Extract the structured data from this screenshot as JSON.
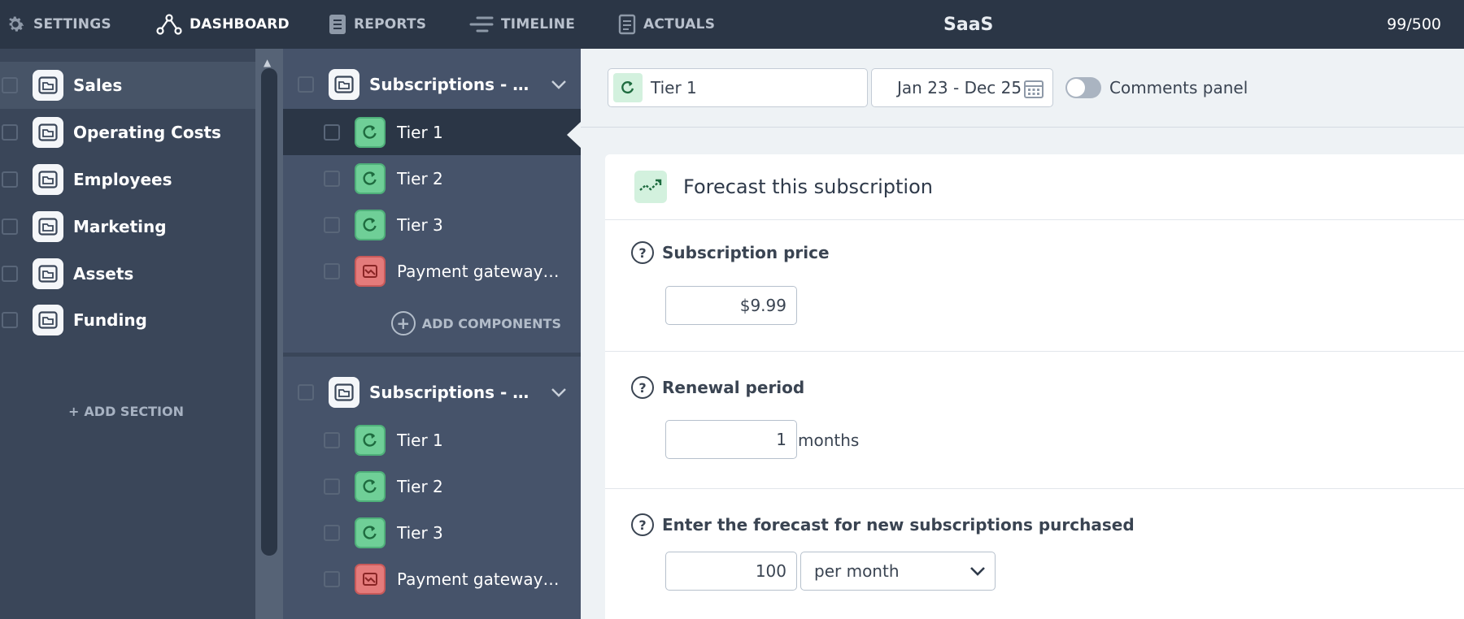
{
  "nav": {
    "settings": "SETTINGS",
    "dashboard": "DASHBOARD",
    "reports": "REPORTS",
    "timeline": "TIMELINE",
    "actuals": "ACTUALS",
    "app_title": "SaaS",
    "usage": "99/500"
  },
  "sidebar": {
    "sections": [
      {
        "label": "Sales"
      },
      {
        "label": "Operating Costs"
      },
      {
        "label": "Employees"
      },
      {
        "label": "Marketing"
      },
      {
        "label": "Assets"
      },
      {
        "label": "Funding"
      }
    ],
    "add_section": "ADD SECTION"
  },
  "components": {
    "group1": {
      "title": "Subscriptions - mo…",
      "items": [
        {
          "label": "Tier 1"
        },
        {
          "label": "Tier 2"
        },
        {
          "label": "Tier 3"
        },
        {
          "label": "Payment gateway c…"
        }
      ]
    },
    "add_components": "ADD COMPONENTS",
    "group2": {
      "title": "Subscriptions - yea…",
      "items": [
        {
          "label": "Tier 1"
        },
        {
          "label": "Tier 2"
        },
        {
          "label": "Tier 3"
        },
        {
          "label": "Payment gateway c…"
        }
      ]
    }
  },
  "toolbar": {
    "tier_selected": "Tier 1",
    "date_range": "Jan 23 - Dec 25",
    "comments_toggle_label": "Comments panel",
    "comments_on": false
  },
  "card": {
    "title": "Forecast this subscription",
    "help_glyph": "?",
    "price_label": "Subscription price",
    "price_value": "$9.99",
    "renewal_label": "Renewal period",
    "renewal_value": "1",
    "renewal_unit": "months",
    "forecast_label": "Enter the forecast for new subscriptions purchased",
    "forecast_value": "100",
    "forecast_period": "per month"
  },
  "colors": {
    "topbar": "#2b3646",
    "sidebar": "#3a4659",
    "component_panel": "#46536a",
    "revenue_green": "#6fcf97",
    "cost_red": "#e47b7b"
  }
}
